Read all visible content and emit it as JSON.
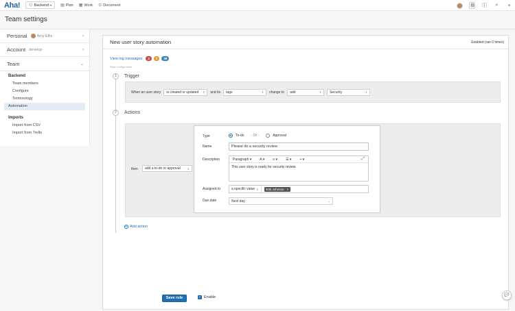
{
  "topnav": {
    "logo": "Aha!",
    "workspace": "Backend",
    "links": [
      {
        "label": "Plan",
        "icon": "plan-icon"
      },
      {
        "label": "Work",
        "icon": "work-icon"
      },
      {
        "label": "Document",
        "icon": "document-icon"
      }
    ],
    "right_icons": [
      "user-avatar",
      "settings-icon",
      "help-icon",
      "search-icon",
      "add-icon"
    ]
  },
  "page_title": "Team settings",
  "sidebar": {
    "personal": {
      "label": "Personal",
      "user": "Amy Ellis"
    },
    "account": {
      "label": "Account",
      "sub": "develop"
    },
    "team": {
      "label": "Team"
    },
    "groups": [
      {
        "title": "Backend",
        "items": [
          "Team members",
          "Configure",
          "Terminology",
          "Automation"
        ]
      },
      {
        "title": "Imports",
        "items": [
          "Import from CSV",
          "Import from Trello"
        ]
      }
    ],
    "active_item": "Automation"
  },
  "rule": {
    "title": "New user story automation",
    "status": "Enabled (ran 0 times)",
    "log_link": "View log messages",
    "log_counts": {
      "error": "3",
      "warning": "2",
      "info": "36"
    },
    "config_label": "Rule configuration"
  },
  "trigger": {
    "step": "1",
    "title": "Trigger",
    "when_text": "When an user story",
    "event": "is created or updated",
    "and_its": "and its",
    "field": "tags",
    "change_to": "change to",
    "operation": "add",
    "value": "Security"
  },
  "actions": {
    "step": "2",
    "title": "Actions",
    "then_text": "then",
    "action_select": "add a to-do or approval",
    "type_label": "Type",
    "type_options": [
      "To-do",
      "- Or -",
      "Approval"
    ],
    "type_selected": "To-do",
    "name_label": "Name",
    "name_value": "Please do a security review",
    "description_label": "Description",
    "toolbar": {
      "paragraph": "Paragraph",
      "font": "A",
      "align": "≡",
      "list": "☰",
      "insert": "+"
    },
    "description_value": "This user story is ready for security review.",
    "assigned_label": "Assigned to",
    "assigned_mode": "a specific value",
    "assignee": "Erik Johnson",
    "due_label": "Due date",
    "due_value": "Next day",
    "add_action": "Add action"
  },
  "footer": {
    "save": "Save rule",
    "enable": "Enable",
    "enabled": true
  },
  "colors": {
    "brand": "#1f5ea8",
    "primary_button": "#1f6fb2",
    "error_pill": "#c94a45",
    "warning_pill": "#e39a35",
    "info_pill": "#3e86b8"
  }
}
